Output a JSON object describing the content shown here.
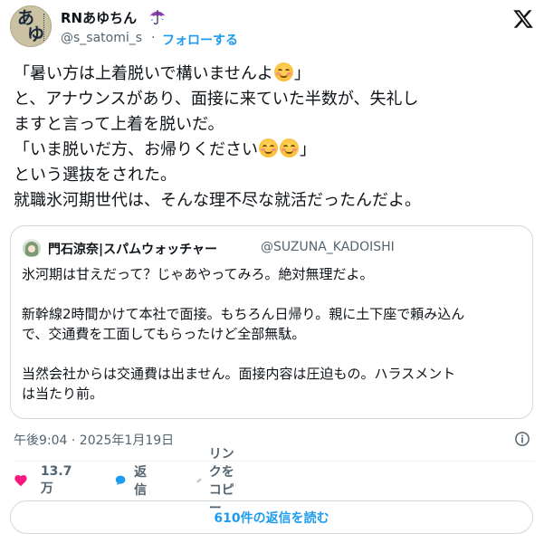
{
  "author": {
    "name": "RNあゆちん",
    "handle": "@s_satomi_s",
    "separator": "·",
    "follow_label": "フォローする",
    "avatar_text": [
      "あ",
      "ゆ"
    ]
  },
  "tweet": {
    "lines": [
      "「暑い方は上着脱いで構いませんよ",
      "」",
      "と、アナウンスがあり、面接に来ていた半数が、失礼し",
      "ますと言って上着を脱いだ。",
      "「いま脱いだ方、お帰りください",
      "」",
      "という選抜をされた。",
      "就職氷河期世代は、そんな理不尽な就活だったんだよ。"
    ],
    "emoji": "smiling-face-with-blush"
  },
  "quoted_tweet": {
    "name": "門石涼奈|スパムウォッチャー",
    "handle": "@SUZUNA_KADOISHI",
    "paragraphs": [
      [
        "氷河期は甘えだって？じゃあやってみろ。絶対無理だよ。"
      ],
      [
        "新幹線2時間かけて本社で面接。もちろん日帰り。親に土下座で頼み込ん",
        "で、交通費を工面してもらったけど全部無駄。"
      ],
      [
        "当然会社からは交通費は出ません。面接内容は圧迫もの。ハラスメント",
        "は当たり前。"
      ]
    ]
  },
  "timestamp": "午後9:04 · 2025年1月19日",
  "actions": {
    "likes": "13.7万",
    "reply": "返信",
    "copy_link": "リンクをコピー"
  },
  "read_replies": "610件の返信を読む",
  "colors": {
    "accent": "#1d9bf0",
    "like": "#f91880",
    "text": "#0f1419",
    "muted": "#536471",
    "border": "#cfd9de"
  }
}
